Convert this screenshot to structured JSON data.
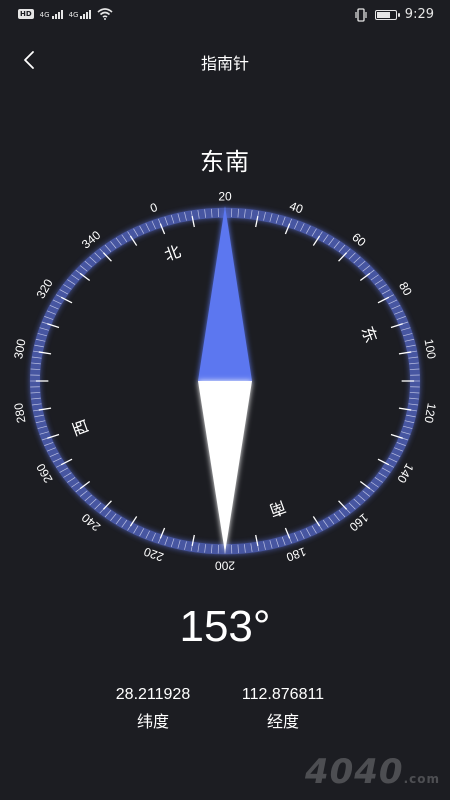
{
  "status_bar": {
    "hd": "HD",
    "network_1": "4G",
    "network_2": "4G",
    "time": "9:29",
    "battery_level": 0.8
  },
  "header": {
    "title": "指南针",
    "back_icon": "chevron-left-icon"
  },
  "compass": {
    "direction_text": "东南",
    "heading_degrees": 153,
    "heading_display": "153°",
    "dial_rotation_degrees": -20,
    "ring_color": "#4f60b8",
    "needle_north_color": "#5b77f0",
    "needle_south_color": "#ffffff",
    "degree_labels": [
      "0",
      "20",
      "40",
      "60",
      "80",
      "100",
      "120",
      "140",
      "160",
      "180",
      "200",
      "220",
      "240",
      "260",
      "280",
      "300",
      "320",
      "340"
    ],
    "cardinals": {
      "north": "北",
      "east": "东",
      "south": "南",
      "west": "西"
    }
  },
  "location": {
    "latitude_value": "28.211928",
    "latitude_label": "纬度",
    "longitude_value": "112.876811",
    "longitude_label": "经度"
  },
  "watermark": {
    "text": "4040",
    "suffix": ".com"
  }
}
